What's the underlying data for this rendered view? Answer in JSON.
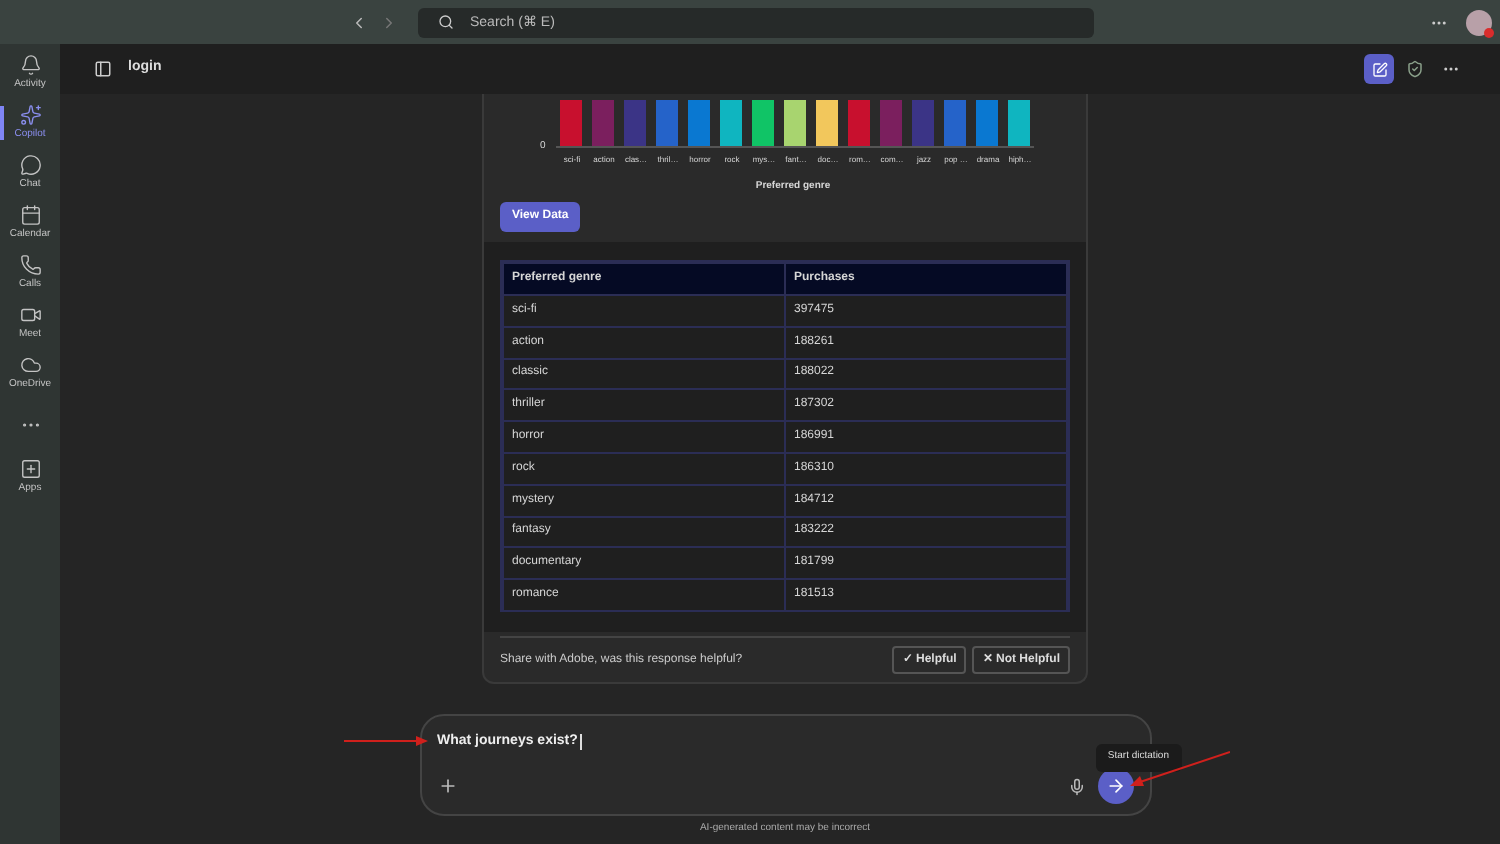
{
  "top_bar": {
    "search": {
      "placeholder": "Search (⌘ E)"
    }
  },
  "rail": [
    {
      "label": "Activity",
      "selected": false
    },
    {
      "label": "Copilot",
      "selected": true
    },
    {
      "label": "Chat",
      "selected": false
    },
    {
      "label": "Calendar",
      "selected": false
    },
    {
      "label": "Calls",
      "selected": false
    },
    {
      "label": "Meet",
      "selected": false
    },
    {
      "label": "OneDrive",
      "selected": false
    },
    {
      "selected": false
    },
    {
      "label": "Apps",
      "selected": false
    }
  ],
  "header": {
    "title": "login"
  },
  "chart": {
    "axis_zero": "0",
    "xlabel": "Preferred genre",
    "bars": [
      {
        "label": "sci-fi",
        "color": "#c8102e"
      },
      {
        "label": "action",
        "color": "#7b1f5e"
      },
      {
        "label": "clas…",
        "color": "#3b3486"
      },
      {
        "label": "thril…",
        "color": "#2563c9"
      },
      {
        "label": "horror",
        "color": "#0a78d1"
      },
      {
        "label": "rock",
        "color": "#0fb5c0"
      },
      {
        "label": "mys…",
        "color": "#10c466"
      },
      {
        "label": "fant…",
        "color": "#a8d46f"
      },
      {
        "label": "doc…",
        "color": "#f2c75c"
      },
      {
        "label": "rom…",
        "color": "#c8102e"
      },
      {
        "label": "com…",
        "color": "#7b1f5e"
      },
      {
        "label": "jazz",
        "color": "#3b3486"
      },
      {
        "label": "pop …",
        "color": "#2563c9"
      },
      {
        "label": "drama",
        "color": "#0a78d1"
      },
      {
        "label": "hiph…",
        "color": "#0fb5c0"
      }
    ]
  },
  "view_data_button": "View Data",
  "table": {
    "columns": [
      "Preferred genre",
      "Purchases"
    ],
    "rows": [
      [
        "sci-fi",
        "397475"
      ],
      [
        "action",
        "188261"
      ],
      [
        "classic",
        "188022"
      ],
      [
        "thriller",
        "187302"
      ],
      [
        "horror",
        "186991"
      ],
      [
        "rock",
        "186310"
      ],
      [
        "mystery",
        "184712"
      ],
      [
        "fantasy",
        "183222"
      ],
      [
        "documentary",
        "181799"
      ],
      [
        "romance",
        "181513"
      ]
    ]
  },
  "feedback": {
    "question": "Share with Adobe, was this response helpful?",
    "buttons": [
      "✓ Helpful",
      "✕ Not Helpful"
    ]
  },
  "composer": {
    "value": "What journeys exist?",
    "tooltip": "Start dictation"
  },
  "disclaimer": "AI-generated content may be incorrect"
}
